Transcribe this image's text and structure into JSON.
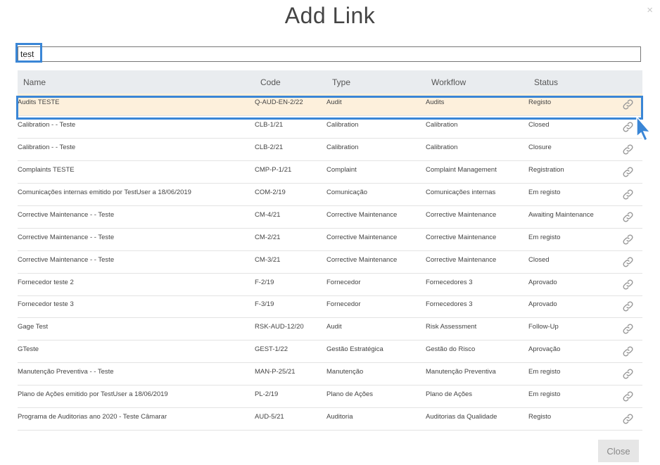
{
  "dialog": {
    "title": "Add Link",
    "close_icon": "×",
    "close_button_label": "Close"
  },
  "search": {
    "value": "test",
    "placeholder": ""
  },
  "table": {
    "headers": {
      "name": "Name",
      "code": "Code",
      "type": "Type",
      "workflow": "Workflow",
      "status": "Status"
    },
    "rows": [
      {
        "name": "Audits TESTE",
        "code": "Q-AUD-EN-2/22",
        "type": "Audit",
        "workflow": "Audits",
        "status": "Registo",
        "selected": true
      },
      {
        "name": "Calibration - - Teste",
        "code": "CLB-1/21",
        "type": "Calibration",
        "workflow": "Calibration",
        "status": "Closed"
      },
      {
        "name": "Calibration - - Teste",
        "code": "CLB-2/21",
        "type": "Calibration",
        "workflow": "Calibration",
        "status": "Closure"
      },
      {
        "name": "Complaints TESTE",
        "code": "CMP-P-1/21",
        "type": "Complaint",
        "workflow": "Complaint Management",
        "status": "Registration"
      },
      {
        "name": "Comunicações internas emitido por TestUser a 18/06/2019",
        "code": "COM-2/19",
        "type": "Comunicação",
        "workflow": "Comunicações internas",
        "status": "Em registo"
      },
      {
        "name": "Corrective Maintenance - - Teste",
        "code": "CM-4/21",
        "type": "Corrective Maintenance",
        "workflow": "Corrective Maintenance",
        "status": "Awaiting Maintenance"
      },
      {
        "name": "Corrective Maintenance - - Teste",
        "code": "CM-2/21",
        "type": "Corrective Maintenance",
        "workflow": "Corrective Maintenance",
        "status": "Em registo"
      },
      {
        "name": "Corrective Maintenance - - Teste",
        "code": "CM-3/21",
        "type": "Corrective Maintenance",
        "workflow": "Corrective Maintenance",
        "status": "Closed"
      },
      {
        "name": "Fornecedor teste 2",
        "code": "F-2/19",
        "type": "Fornecedor",
        "workflow": "Fornecedores 3",
        "status": "Aprovado"
      },
      {
        "name": "Fornecedor teste 3",
        "code": "F-3/19",
        "type": "Fornecedor",
        "workflow": "Fornecedores 3",
        "status": "Aprovado"
      },
      {
        "name": "Gage Test",
        "code": "RSK-AUD-12/20",
        "type": "Audit",
        "workflow": "Risk Assessment",
        "status": "Follow-Up"
      },
      {
        "name": "GTeste",
        "code": "GEST-1/22",
        "type": "Gestão Estratégica",
        "workflow": "Gestão do Risco",
        "status": "Aprovação"
      },
      {
        "name": "Manutenção Preventiva - - Teste",
        "code": "MAN-P-25/21",
        "type": "Manutenção",
        "workflow": "Manutenção Preventiva",
        "status": "Em registo"
      },
      {
        "name": "Plano de Ações emitido por TestUser a 18/06/2019",
        "code": "PL-2/19",
        "type": "Plano de Ações",
        "workflow": "Plano de Ações",
        "status": "Em registo"
      },
      {
        "name": "Programa de Auditorias ano 2020 - Teste Câmarar",
        "code": "AUD-5/21",
        "type": "Auditoria",
        "workflow": "Auditorias da Qualidade",
        "status": "Registo"
      }
    ]
  },
  "icons": {
    "row_action": "link-icon",
    "dialog_close": "close-icon"
  },
  "colors": {
    "highlight": "#3a86d6",
    "selected_row": "#fdf0dc",
    "header_bg": "#e9ecef"
  }
}
